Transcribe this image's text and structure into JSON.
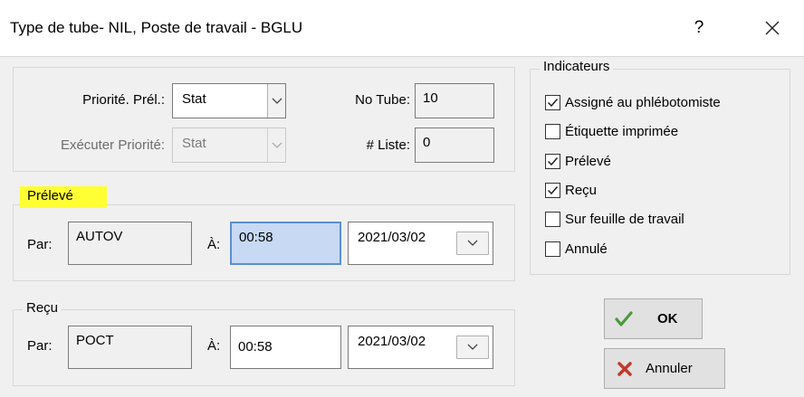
{
  "window": {
    "title": "Type de tube- NIL, Poste de travail - BGLU",
    "help_label": "?",
    "close_icon": "close-icon"
  },
  "top_section": {
    "priorite_prel_label": "Priorité. Prél.:",
    "priorite_prel_value": "Stat",
    "executer_priorite_label": "Exécuter Priorité:",
    "executer_priorite_value": "Stat",
    "no_tube_label": "No Tube:",
    "no_tube_value": "10",
    "liste_label": "# Liste:",
    "liste_value": "0"
  },
  "preleve": {
    "legend": "Prélevé",
    "par_label": "Par:",
    "par_value": "AUTOV",
    "a_label": "À:",
    "time_value": "00:58",
    "date_value": "2021/03/02"
  },
  "recu": {
    "legend": "Reçu",
    "par_label": "Par:",
    "par_value": "POCT",
    "a_label": "À:",
    "time_value": "00:58",
    "date_value": "2021/03/02"
  },
  "indicateurs": {
    "legend": "Indicateurs",
    "items": [
      {
        "label": "Assigné au phlébotomiste",
        "checked": true
      },
      {
        "label": "Étiquette imprimée",
        "checked": false
      },
      {
        "label": "Prélevé",
        "checked": true
      },
      {
        "label": "Reçu",
        "checked": true
      },
      {
        "label": "Sur feuille de travail",
        "checked": false
      },
      {
        "label": "Annulé",
        "checked": false
      }
    ]
  },
  "buttons": {
    "ok_label": "OK",
    "annuler_label": "Annuler"
  },
  "colors": {
    "highlight_yellow": "#ffff33",
    "time_selected_bg": "#c7d9f3",
    "ok_check_green": "#4a9a3c",
    "annuler_x_red": "#c0392b"
  }
}
